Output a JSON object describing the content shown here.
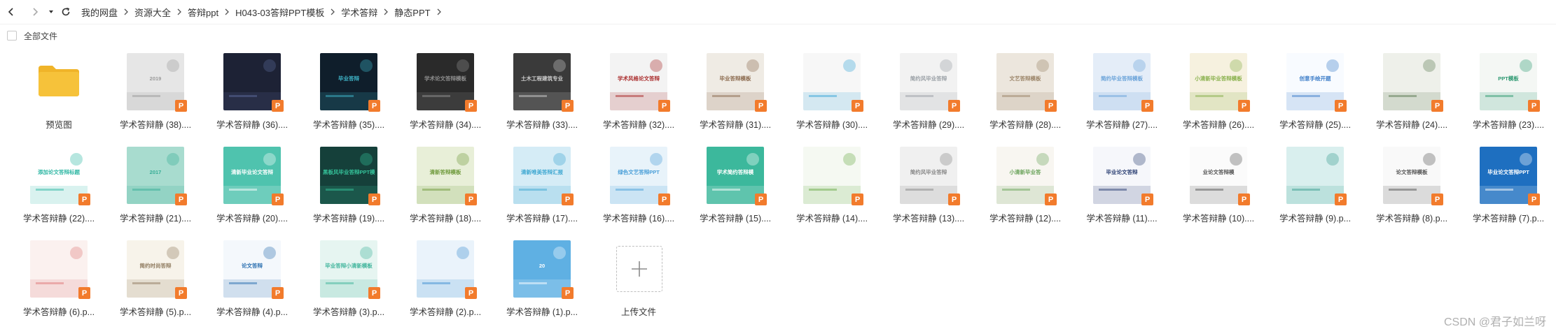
{
  "breadcrumb": [
    "我的网盘",
    "资源大全",
    "答辩ppt",
    "H043-03答辩PPT模板",
    "学术答辩",
    "静态PPT"
  ],
  "select_all_label": "全部文件",
  "colors": {
    "badge": "#f27b2c",
    "folder": "#f6c23a"
  },
  "files": [
    {
      "name": "预览图",
      "kind": "folder"
    },
    {
      "name": "学术答辩静 (38)....",
      "kind": "ppt",
      "bg": "#e6e6e6",
      "accent": "#9a9a9a",
      "text": "2019"
    },
    {
      "name": "学术答辩静 (36)....",
      "kind": "ppt",
      "bg": "#1d2235",
      "accent": "#5c6a9c",
      "text": ""
    },
    {
      "name": "学术答辩静 (35)....",
      "kind": "ppt",
      "bg": "#0f1e2b",
      "accent": "#3fb6c9",
      "text": "毕业答辩"
    },
    {
      "name": "学术答辩静 (34)....",
      "kind": "ppt",
      "bg": "#2a2a2a",
      "accent": "#8f8f8f",
      "text": "学术论文答辩模板"
    },
    {
      "name": "学术答辩静 (33)....",
      "kind": "ppt",
      "bg": "#3a3a3a",
      "accent": "#cccccc",
      "text": "土木工程建筑专业"
    },
    {
      "name": "学术答辩静 (32)....",
      "kind": "ppt",
      "bg": "#f3f3f3",
      "accent": "#a92a2a",
      "text": "学术风格论文答辩"
    },
    {
      "name": "学术答辩静 (31)....",
      "kind": "ppt",
      "bg": "#efebe4",
      "accent": "#8c6b4f",
      "text": "毕业答辩模板"
    },
    {
      "name": "学术答辩静 (30)....",
      "kind": "ppt",
      "bg": "#f7f7f7",
      "accent": "#3aa5d8",
      "text": ""
    },
    {
      "name": "学术答辩静 (29)....",
      "kind": "ppt",
      "bg": "#f2f2f2",
      "accent": "#9aa0a6",
      "text": "简约风毕业答辩"
    },
    {
      "name": "学术答辩静 (28)....",
      "kind": "ppt",
      "bg": "#ece6dd",
      "accent": "#9b8468",
      "text": "文艺答辩模板"
    },
    {
      "name": "学术答辩静 (27)....",
      "kind": "ppt",
      "bg": "#e4edf8",
      "accent": "#6aa3d9",
      "text": "简约毕业答辩模板"
    },
    {
      "name": "学术答辩静 (26)....",
      "kind": "ppt",
      "bg": "#f6f1df",
      "accent": "#88b04b",
      "text": "小清新毕业答辩模板"
    },
    {
      "name": "学术答辩静 (25)....",
      "kind": "ppt",
      "bg": "#f8fbff",
      "accent": "#3d7ec9",
      "text": "创意手绘开题"
    },
    {
      "name": "学术答辩静 (24)....",
      "kind": "ppt",
      "bg": "#eef0ea",
      "accent": "#5b7a52",
      "text": ""
    },
    {
      "name": "学术答辩静 (23)....",
      "kind": "ppt",
      "bg": "#f4f7f4",
      "accent": "#2f9a72",
      "text": "PPT模板"
    },
    {
      "name": "学术答辩静 (22)....",
      "kind": "ppt",
      "bg": "#ffffff",
      "accent": "#2fb7a4",
      "text": "添加论文答辩标题"
    },
    {
      "name": "学术答辩静 (21)....",
      "kind": "ppt",
      "bg": "#a8dccf",
      "accent": "#37ae96",
      "text": "2017"
    },
    {
      "name": "学术答辩静 (20)....",
      "kind": "ppt",
      "bg": "#4fc3ae",
      "accent": "#ffffff",
      "text": "清新毕业论文答辩"
    },
    {
      "name": "学术答辩静 (19)....",
      "kind": "ppt",
      "bg": "#15403a",
      "accent": "#35c29a",
      "text": "黑板风毕业答辩PPT模板"
    },
    {
      "name": "学术答辩静 (18)....",
      "kind": "ppt",
      "bg": "#e8efd8",
      "accent": "#6f9a3c",
      "text": "清新答辩模板"
    },
    {
      "name": "学术答辩静 (17)....",
      "kind": "ppt",
      "bg": "#d5ecf6",
      "accent": "#3ea7d1",
      "text": "清新唯美答辩汇报"
    },
    {
      "name": "学术答辩静 (16)....",
      "kind": "ppt",
      "bg": "#e8f3fa",
      "accent": "#4a9fd8",
      "text": "绿色文艺答辩PPT"
    },
    {
      "name": "学术答辩静 (15)....",
      "kind": "ppt",
      "bg": "#3cb89c",
      "accent": "#ffffff",
      "text": "学术简约答辩模"
    },
    {
      "name": "学术答辩静 (14)....",
      "kind": "ppt",
      "bg": "#f5f9f2",
      "accent": "#6cab4a",
      "text": ""
    },
    {
      "name": "学术答辩静 (13)....",
      "kind": "ppt",
      "bg": "#f0f0f0",
      "accent": "#888888",
      "text": "简约风毕业答辩"
    },
    {
      "name": "学术答辩静 (12)....",
      "kind": "ppt",
      "bg": "#f8f6f1",
      "accent": "#6aa35a",
      "text": "小清新毕业答"
    },
    {
      "name": "学术答辩静 (11)....",
      "kind": "ppt",
      "bg": "#f6f7fb",
      "accent": "#2b3f73",
      "text": "毕业论文答辩"
    },
    {
      "name": "学术答辩静 (10)....",
      "kind": "ppt",
      "bg": "#fbfbfb",
      "accent": "#555555",
      "text": "业论文答辩模"
    },
    {
      "name": "学术答辩静 (9).p...",
      "kind": "ppt",
      "bg": "#d9efee",
      "accent": "#3a9e8f",
      "text": ""
    },
    {
      "name": "学术答辩静 (8).p...",
      "kind": "ppt",
      "bg": "#f9f9f9",
      "accent": "#555555",
      "text": "论文答辩模板"
    },
    {
      "name": "学术答辩静 (7).p...",
      "kind": "ppt",
      "bg": "#1e6fc0",
      "accent": "#ffffff",
      "text": "毕业论文答辩PPT"
    },
    {
      "name": "学术答辩静 (6).p...",
      "kind": "ppt",
      "bg": "#fbf1ef",
      "accent": "#e07a7a",
      "text": ""
    },
    {
      "name": "学术答辩静 (5).p...",
      "kind": "ppt",
      "bg": "#f7f3ea",
      "accent": "#8f7b5f",
      "text": "简约时尚答辩"
    },
    {
      "name": "学术答辩静 (4).p...",
      "kind": "ppt",
      "bg": "#f4f8fc",
      "accent": "#2a6fb0",
      "text": "论文答辩"
    },
    {
      "name": "学术答辩静 (3).p...",
      "kind": "ppt",
      "bg": "#e6f5f1",
      "accent": "#40b59c",
      "text": "毕业答辩小清新模板"
    },
    {
      "name": "学术答辩静 (2).p...",
      "kind": "ppt",
      "bg": "#eaf3fb",
      "accent": "#3f8fd1",
      "text": ""
    },
    {
      "name": "学术答辩静 (1).p...",
      "kind": "ppt",
      "bg": "#5fb0e3",
      "accent": "#ffffff",
      "text": "20"
    },
    {
      "name": "上传文件",
      "kind": "upload"
    }
  ],
  "watermark": "CSDN @君子如兰呀"
}
